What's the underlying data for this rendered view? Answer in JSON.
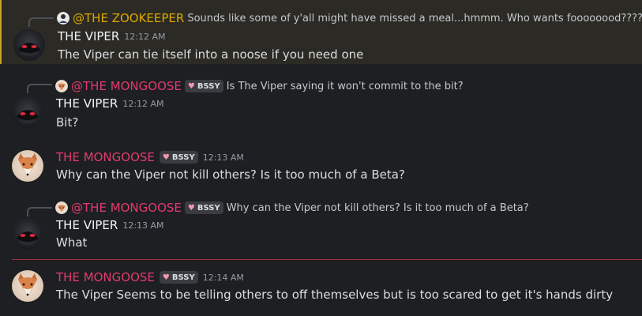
{
  "colors": {
    "background": "#1e1f22",
    "highlight_bg": "#2b2a24",
    "highlight_border": "#c9a227",
    "mongoose_name": "#e23b6e",
    "zookeeper_name": "#e0a800",
    "viper_name": "#f2f3f5",
    "new_divider": "#a12d35"
  },
  "messages": [
    {
      "reply": {
        "author": "@THE ZOOKEEPER",
        "text": "Sounds like some of y'all might have missed a meal...hmmm. Who wants foooooood????"
      },
      "author": "THE VIPER",
      "timestamp": "12:12 AM",
      "text": "The Viper can tie itself into a noose if you need one"
    },
    {
      "reply": {
        "author": "@THE MONGOOSE",
        "badge": "BSSY",
        "text": "Is The Viper saying it won't commit to the bit?"
      },
      "author": "THE VIPER",
      "timestamp": "12:12 AM",
      "text": "Bit?"
    },
    {
      "author": "THE MONGOOSE",
      "badge": "BSSY",
      "timestamp": "12:13 AM",
      "text": "Why can the Viper not kill others? Is it too much of a Beta?"
    },
    {
      "reply": {
        "author": "@THE MONGOOSE",
        "badge": "BSSY",
        "text": "Why can the Viper not kill others? Is it too much of a Beta?"
      },
      "author": "THE VIPER",
      "timestamp": "12:13 AM",
      "text": "What"
    },
    {
      "author": "THE MONGOOSE",
      "badge": "BSSY",
      "timestamp": "12:14 AM",
      "text": "The Viper Seems to be telling others to off themselves but is too scared to get it's hands dirty"
    }
  ]
}
